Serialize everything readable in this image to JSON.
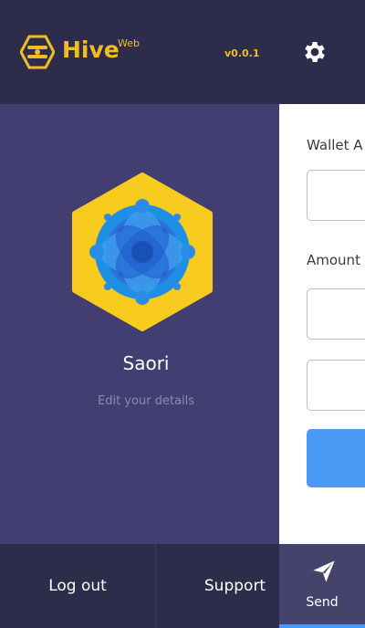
{
  "app": {
    "settings_icon": "gear-icon",
    "form": {
      "wallet_label": "Wallet A",
      "amount_label": "Amount"
    },
    "tabs": {
      "send": {
        "label": "Send",
        "icon": "paper-plane-icon"
      }
    },
    "colors": {
      "accent": "#4a9af5",
      "brand": "#f1be22"
    }
  },
  "menu": {
    "brand_name": "Hive",
    "brand_suffix": "Web",
    "version": "v0.0.1",
    "user": {
      "name": "Saori",
      "edit_link": "Edit your details"
    },
    "footer": {
      "logout": "Log out",
      "support": "Support"
    }
  }
}
